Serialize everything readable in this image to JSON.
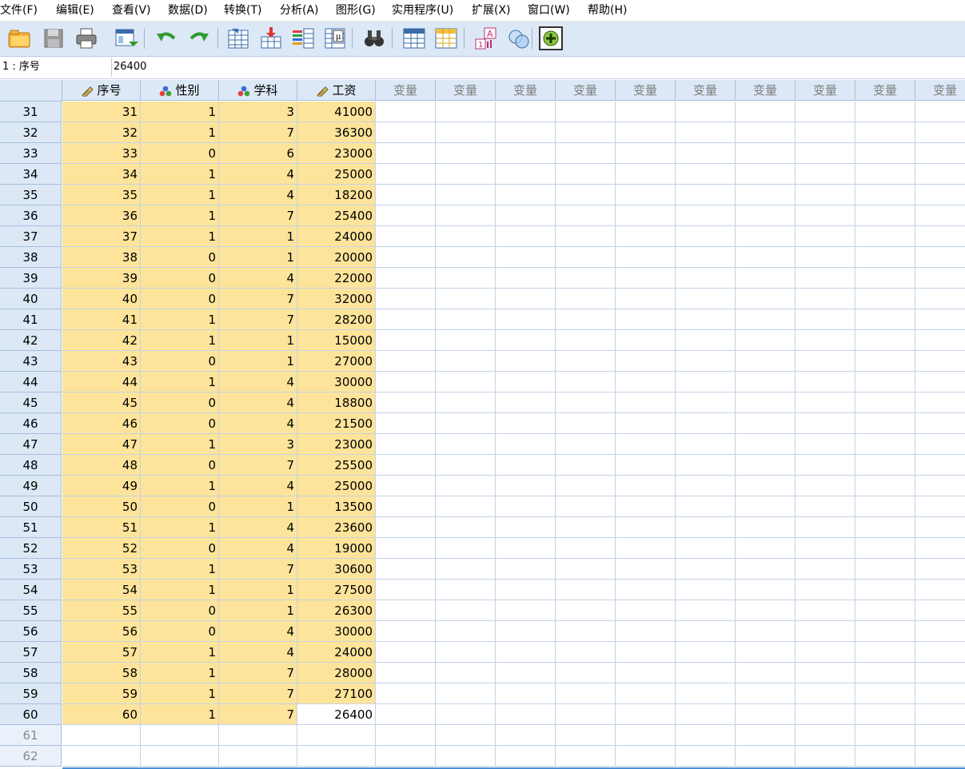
{
  "menu": [
    "文件(F)",
    "编辑(E)",
    "查看(V)",
    "数据(D)",
    "转换(T)",
    "分析(A)",
    "图形(G)",
    "实用程序(U)",
    "扩展(X)",
    "窗口(W)",
    "帮助(H)"
  ],
  "toolbar": [
    {
      "name": "open-icon"
    },
    {
      "name": "save-icon"
    },
    {
      "name": "print-icon"
    },
    {
      "name": "dialog-recall-icon"
    },
    {
      "name": "undo-icon"
    },
    {
      "name": "redo-icon"
    },
    {
      "name": "goto-case-icon"
    },
    {
      "name": "goto-variable-icon"
    },
    {
      "name": "variables-icon"
    },
    {
      "name": "run-descriptives-icon"
    },
    {
      "name": "find-icon"
    },
    {
      "name": "insert-cases-icon"
    },
    {
      "name": "insert-variable-icon"
    },
    {
      "name": "value-labels-icon"
    },
    {
      "name": "use-sets-icon"
    },
    {
      "name": "add-extension-icon"
    }
  ],
  "cell_editor": {
    "ref": "1 : 序号",
    "value": "26400"
  },
  "columns": [
    {
      "label": "序号",
      "icon": "scale"
    },
    {
      "label": "性别",
      "icon": "nominal"
    },
    {
      "label": "学科",
      "icon": "nominal"
    },
    {
      "label": "工资",
      "icon": "scale"
    },
    {
      "label": "变量"
    },
    {
      "label": "变量"
    },
    {
      "label": "变量"
    },
    {
      "label": "变量"
    },
    {
      "label": "变量"
    },
    {
      "label": "变量"
    },
    {
      "label": "变量"
    },
    {
      "label": "变量"
    },
    {
      "label": "变量"
    },
    {
      "label": "变量"
    }
  ],
  "rows": [
    {
      "n": "31",
      "v": [
        "31",
        "1",
        "3",
        "41000"
      ]
    },
    {
      "n": "32",
      "v": [
        "32",
        "1",
        "7",
        "36300"
      ]
    },
    {
      "n": "33",
      "v": [
        "33",
        "0",
        "6",
        "23000"
      ]
    },
    {
      "n": "34",
      "v": [
        "34",
        "1",
        "4",
        "25000"
      ]
    },
    {
      "n": "35",
      "v": [
        "35",
        "1",
        "4",
        "18200"
      ]
    },
    {
      "n": "36",
      "v": [
        "36",
        "1",
        "7",
        "25400"
      ]
    },
    {
      "n": "37",
      "v": [
        "37",
        "1",
        "1",
        "24000"
      ]
    },
    {
      "n": "38",
      "v": [
        "38",
        "0",
        "1",
        "20000"
      ]
    },
    {
      "n": "39",
      "v": [
        "39",
        "0",
        "4",
        "22000"
      ]
    },
    {
      "n": "40",
      "v": [
        "40",
        "0",
        "7",
        "32000"
      ]
    },
    {
      "n": "41",
      "v": [
        "41",
        "1",
        "7",
        "28200"
      ]
    },
    {
      "n": "42",
      "v": [
        "42",
        "1",
        "1",
        "15000"
      ]
    },
    {
      "n": "43",
      "v": [
        "43",
        "0",
        "1",
        "27000"
      ]
    },
    {
      "n": "44",
      "v": [
        "44",
        "1",
        "4",
        "30000"
      ]
    },
    {
      "n": "45",
      "v": [
        "45",
        "0",
        "4",
        "18800"
      ]
    },
    {
      "n": "46",
      "v": [
        "46",
        "0",
        "4",
        "21500"
      ]
    },
    {
      "n": "47",
      "v": [
        "47",
        "1",
        "3",
        "23000"
      ]
    },
    {
      "n": "48",
      "v": [
        "48",
        "0",
        "7",
        "25500"
      ]
    },
    {
      "n": "49",
      "v": [
        "49",
        "1",
        "4",
        "25000"
      ]
    },
    {
      "n": "50",
      "v": [
        "50",
        "0",
        "1",
        "13500"
      ]
    },
    {
      "n": "51",
      "v": [
        "51",
        "1",
        "4",
        "23600"
      ]
    },
    {
      "n": "52",
      "v": [
        "52",
        "0",
        "4",
        "19000"
      ]
    },
    {
      "n": "53",
      "v": [
        "53",
        "1",
        "7",
        "30600"
      ]
    },
    {
      "n": "54",
      "v": [
        "54",
        "1",
        "1",
        "27500"
      ]
    },
    {
      "n": "55",
      "v": [
        "55",
        "0",
        "1",
        "26300"
      ]
    },
    {
      "n": "56",
      "v": [
        "56",
        "0",
        "4",
        "30000"
      ]
    },
    {
      "n": "57",
      "v": [
        "57",
        "1",
        "4",
        "24000"
      ]
    },
    {
      "n": "58",
      "v": [
        "58",
        "1",
        "7",
        "28000"
      ]
    },
    {
      "n": "59",
      "v": [
        "59",
        "1",
        "7",
        "27100"
      ]
    },
    {
      "n": "60",
      "v": [
        "60",
        "1",
        "7",
        "26400"
      ]
    },
    {
      "n": "61",
      "v": []
    },
    {
      "n": "62",
      "v": []
    }
  ],
  "colors": {
    "selected_fill": "#fde49a",
    "header_bg": "#dce8f6",
    "grid_line": "#c3d3e6"
  }
}
